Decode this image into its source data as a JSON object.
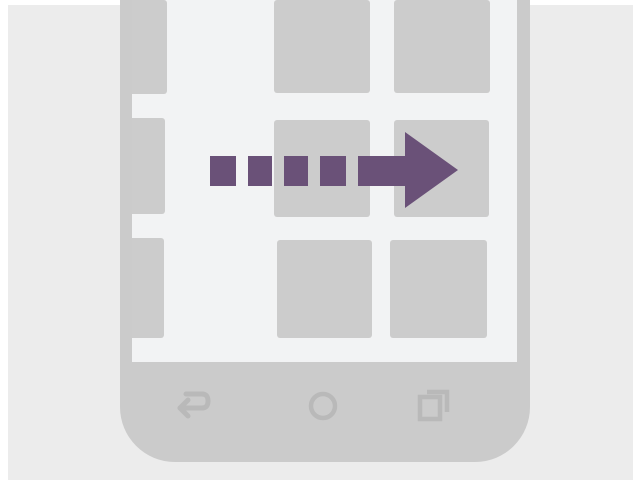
{
  "illustration": {
    "gesture": "swipe-right",
    "arrow_color": "#6a5178",
    "phone_color": "#cbcbcb",
    "screen_color": "#f2f3f4",
    "tile_color": "#cccccc",
    "background_color": "#ececec"
  },
  "navigation_bar": {
    "buttons": [
      {
        "icon": "back-icon"
      },
      {
        "icon": "home-icon"
      },
      {
        "icon": "recent-apps-icon"
      }
    ],
    "icon_color": "#b9b9b9"
  }
}
